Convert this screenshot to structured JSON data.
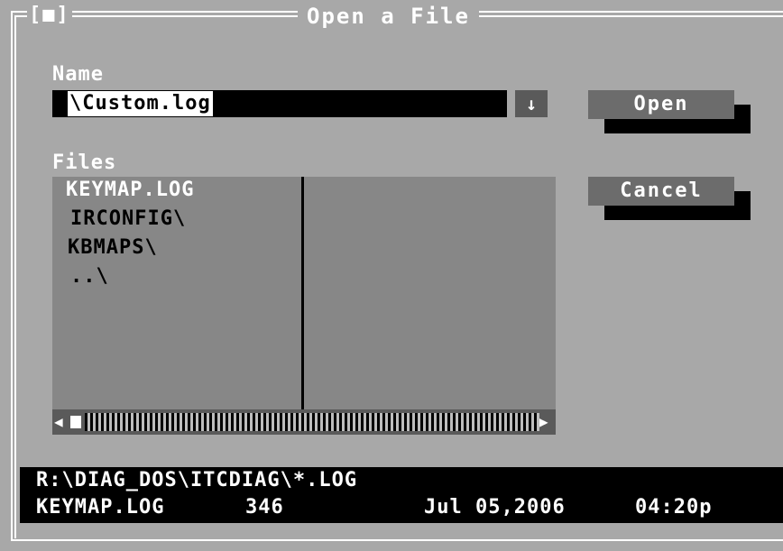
{
  "dialog": {
    "title": "Open a File",
    "close_box": "[■]"
  },
  "name": {
    "label": "Name",
    "value": "\\Custom.log",
    "dropdown_glyph": "↓"
  },
  "files": {
    "label": "Files",
    "items": [
      "KEYMAP.LOG",
      "IRCONFIG\\",
      "KBMAPS\\",
      "..\\"
    ],
    "selected_index": 0
  },
  "buttons": {
    "open": "Open",
    "cancel": "Cancel"
  },
  "status": {
    "path": "R:\\DIAG_DOS\\ITCDIAG\\*.LOG",
    "file_name": "KEYMAP.LOG",
    "file_size": "346",
    "file_date": "Jul 05,2006",
    "file_time": "04:20p"
  }
}
